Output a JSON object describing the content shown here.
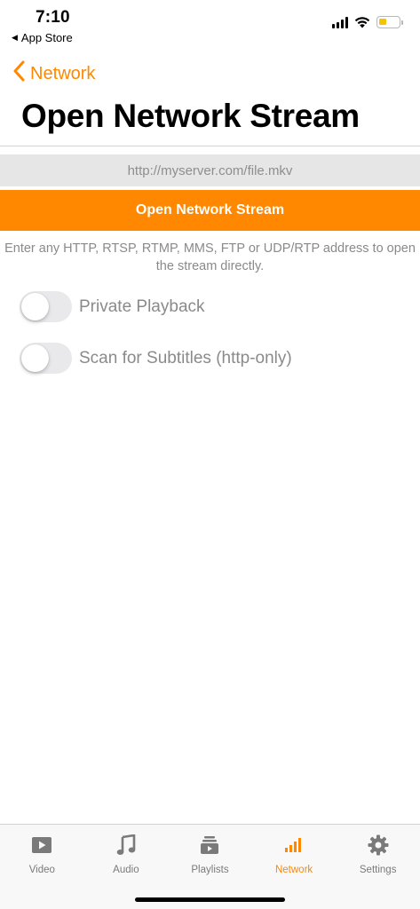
{
  "status_bar": {
    "time": "7:10",
    "back_app": "App Store",
    "battery_color": "#f5c400"
  },
  "nav": {
    "back_label": "Network"
  },
  "page": {
    "title": "Open Network Stream"
  },
  "url_input": {
    "placeholder": "http://myserver.com/file.mkv",
    "value": ""
  },
  "open_button": {
    "label": "Open Network Stream"
  },
  "help_text": "Enter any HTTP, RTSP, RTMP, MMS, FTP or UDP/RTP address to open the stream directly.",
  "toggles": [
    {
      "label": "Private Playback",
      "on": false
    },
    {
      "label": "Scan for Subtitles (http-only)",
      "on": false
    }
  ],
  "tab_bar": {
    "tabs": [
      {
        "label": "Video",
        "icon": "video-icon",
        "active": false
      },
      {
        "label": "Audio",
        "icon": "music-note-icon",
        "active": false
      },
      {
        "label": "Playlists",
        "icon": "playlist-icon",
        "active": false
      },
      {
        "label": "Network",
        "icon": "network-bars-icon",
        "active": true
      },
      {
        "label": "Settings",
        "icon": "gear-icon",
        "active": false
      }
    ]
  },
  "colors": {
    "accent": "#ff8800",
    "inactive_tab": "#7a7a7a",
    "toggle_off": "#e9e9eb"
  }
}
